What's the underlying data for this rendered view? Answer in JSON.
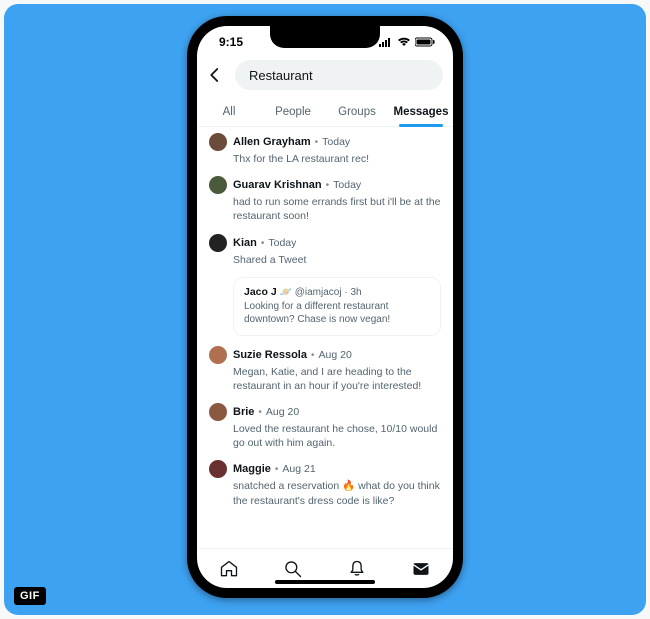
{
  "badge": "GIF",
  "status": {
    "time": "9:15"
  },
  "search": {
    "query": "Restaurant"
  },
  "tabs": [
    {
      "label": "All",
      "active": false
    },
    {
      "label": "People",
      "active": false
    },
    {
      "label": "Groups",
      "active": false
    },
    {
      "label": "Messages",
      "active": true
    }
  ],
  "messages": [
    {
      "name": "Allen Grayham",
      "date": "Today",
      "body": "Thx for the LA restaurant rec!",
      "avatar_color": "#6b4c3a"
    },
    {
      "name": "Guarav Krishnan",
      "date": "Today",
      "body": "had to run some errands first but i'll be at the restaurant soon!",
      "avatar_color": "#4a5a3a"
    },
    {
      "name": "Kian",
      "date": "Today",
      "body": "Shared a Tweet",
      "avatar_color": "#222222",
      "quoted": {
        "name": "Jaco J",
        "emoji": "🪐",
        "handle": "@iamjacoj",
        "time": "3h",
        "body": "Looking for a different restaurant downtown? Chase is now vegan!"
      }
    },
    {
      "name": "Suzie Ressola",
      "date": "Aug 20",
      "body": "Megan, Katie, and I are heading to the restaurant in an hour if you're interested!",
      "avatar_color": "#b07050"
    },
    {
      "name": "Brie",
      "date": "Aug 20",
      "body": "Loved the restaurant he chose, 10/10 would go out with him again.",
      "avatar_color": "#8a5a40"
    },
    {
      "name": "Maggie",
      "date": "Aug 21",
      "body": "snatched a reservation 🔥 what do you think the restaurant's dress code is like?",
      "avatar_color": "#6a3030"
    }
  ],
  "nav_icons": [
    "home-icon",
    "search-icon",
    "notifications-icon",
    "messages-icon"
  ]
}
